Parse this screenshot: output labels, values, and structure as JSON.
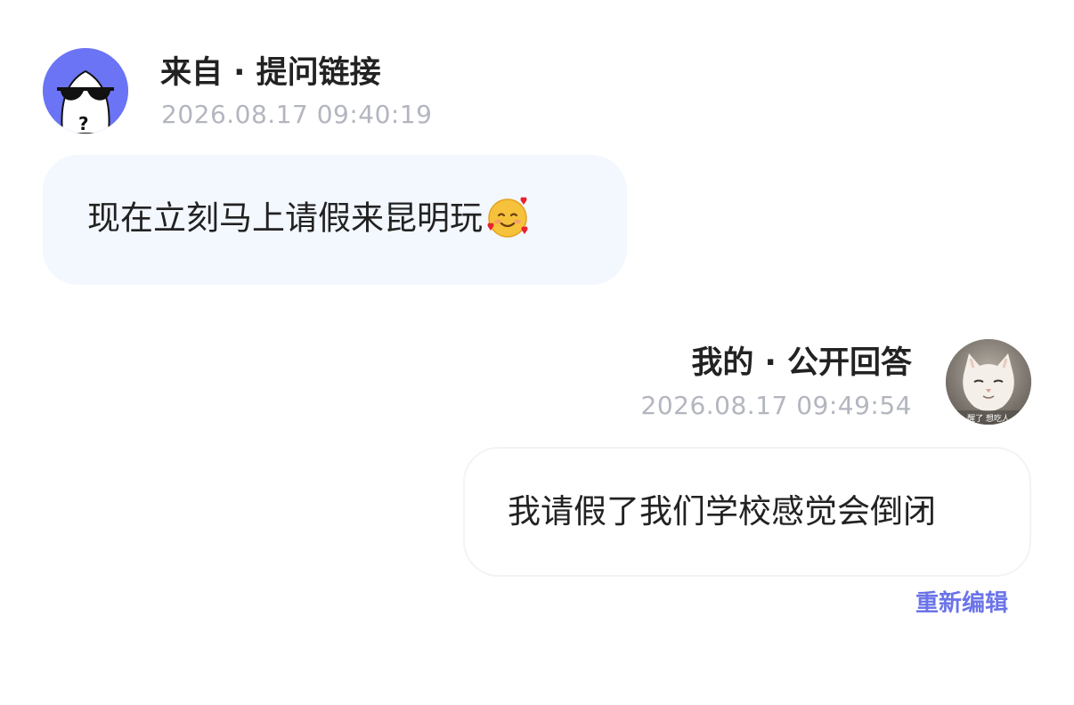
{
  "question": {
    "source_title": "来自 · 提问链接",
    "timestamp": "2026.08.17 09:40:19",
    "text": "现在立刻马上请假来昆明玩",
    "emoji": "smiling-face-with-hearts",
    "avatar": "anonymous-sunglasses-avatar",
    "accent_color": "#6b74f4",
    "bubble_color": "#f3f7fe"
  },
  "answer": {
    "title": "我的 · 公开回答",
    "timestamp": "2026.08.17 09:49:54",
    "text": "我请假了我们学校感觉会倒闭",
    "avatar": "cat-photo-avatar",
    "avatar_caption": "醒了 想吃人",
    "edit_label": "重新编辑",
    "link_color": "#6b74e8"
  }
}
